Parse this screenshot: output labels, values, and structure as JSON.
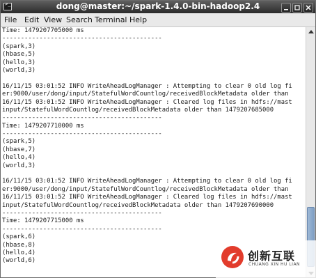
{
  "window": {
    "title": "dong@master:~/spark-1.4.0-bin-hadoop2.4",
    "icon": "terminal-icon",
    "buttons": [
      "minimize-icon",
      "maximize-icon",
      "close-icon"
    ]
  },
  "menu": {
    "items": [
      {
        "label": "File"
      },
      {
        "label": "Edit"
      },
      {
        "label": "View"
      },
      {
        "label": "Search"
      },
      {
        "label": "Terminal"
      },
      {
        "label": "Help"
      }
    ]
  },
  "terminal": {
    "lines": [
      "Time: 1479207705000 ms",
      "-------------------------------------------",
      "(spark,3)",
      "(hbase,5)",
      "(hello,3)",
      "(world,3)",
      "",
      "16/11/15 03:01:52 INFO WriteAheadLogManager : Attempting to clear 0 old log fi",
      "er:9000/user/dong/input/StatefulWordCountlog/receivedBlockMetadata older than",
      "16/11/15 03:01:52 INFO WriteAheadLogManager : Cleared log files in hdfs://mast",
      "input/StatefulWordCountlog/receivedBlockMetadata older than 1479207685000",
      "-------------------------------------------",
      "Time: 1479207710000 ms",
      "-------------------------------------------",
      "(spark,5)",
      "(hbase,7)",
      "(hello,4)",
      "(world,3)",
      "",
      "16/11/15 03:01:52 INFO WriteAheadLogManager : Attempting to clear 0 old log fi",
      "er:9000/user/dong/input/StatefulWordCountlog/receivedBlockMetadata older than",
      "16/11/15 03:01:52 INFO WriteAheadLogManager : Cleared log files in hdfs://mast",
      "input/StatefulWordCountlog/receivedBlockMetadata older than 1479207690000",
      "-------------------------------------------",
      "Time: 1479207715000 ms",
      "-------------------------------------------",
      "(spark,6)",
      "(hbase,8)",
      "(hello,4)",
      "(world,6)"
    ]
  },
  "watermark": {
    "name": "创新互联",
    "sub": "CHUANG XIN HU LIAN",
    "color": "#e23c2c"
  }
}
